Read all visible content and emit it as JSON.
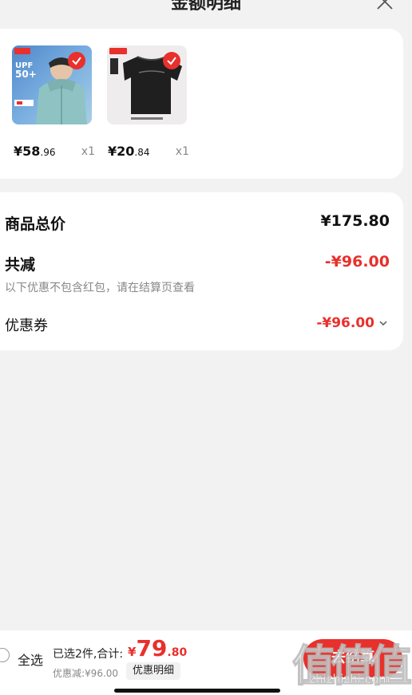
{
  "sheet": {
    "title": "金额明细"
  },
  "products": [
    {
      "price_int": "¥58",
      "price_dec": ".96",
      "qty": "x1",
      "thumb_badges": [
        "UPF",
        "50+"
      ]
    },
    {
      "price_int": "¥20",
      "price_dec": ".84",
      "qty": "x1"
    }
  ],
  "summary": {
    "total_label": "商品总价",
    "total_value": "¥175.80",
    "reduce_label": "共减",
    "reduce_value": "-¥96.00",
    "note": "以下优惠不包含红包，请在结算页查看",
    "coupon_label": "优惠券",
    "coupon_value": "-¥96.00"
  },
  "bottom_bar": {
    "select_all": "全选",
    "selected_info": "已选2件,合计:",
    "total_symbol": "¥",
    "total_int": "79",
    "total_dec": ".80",
    "discount_note": "优惠减:¥96.00",
    "detail_button": "优惠明细",
    "checkout": "去结算"
  },
  "watermark": {
    "text": "值",
    "site": "zhizhizhi.com"
  },
  "colors": {
    "accent": "#e8302c",
    "background": "#f2f2f2",
    "card": "#ffffff",
    "muted": "#888888"
  }
}
